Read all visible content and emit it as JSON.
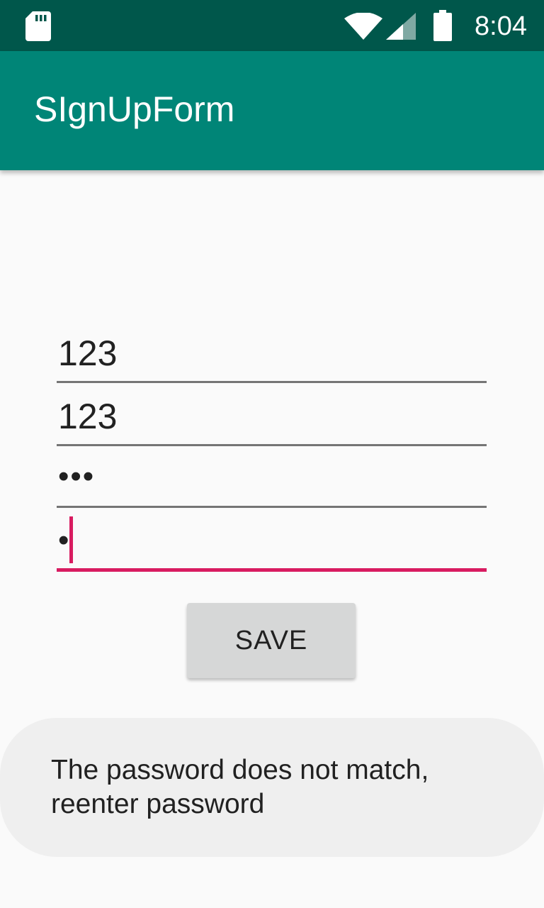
{
  "status_bar": {
    "time": "8:04",
    "icons": [
      "sd-card-icon",
      "wifi-icon",
      "cell-signal-icon",
      "battery-icon"
    ],
    "background": "#00574b"
  },
  "app_bar": {
    "title": "SIgnUpForm",
    "background": "#008577"
  },
  "form": {
    "fields": [
      {
        "value": "123",
        "type": "text"
      },
      {
        "value": "123",
        "type": "text"
      },
      {
        "value": "•••",
        "type": "password"
      },
      {
        "value": "•",
        "type": "password",
        "focused": true
      }
    ],
    "accent_color": "#d81b60"
  },
  "save_button": {
    "label": "SAVE"
  },
  "toast": {
    "message": "The password does not match, reenter password"
  }
}
